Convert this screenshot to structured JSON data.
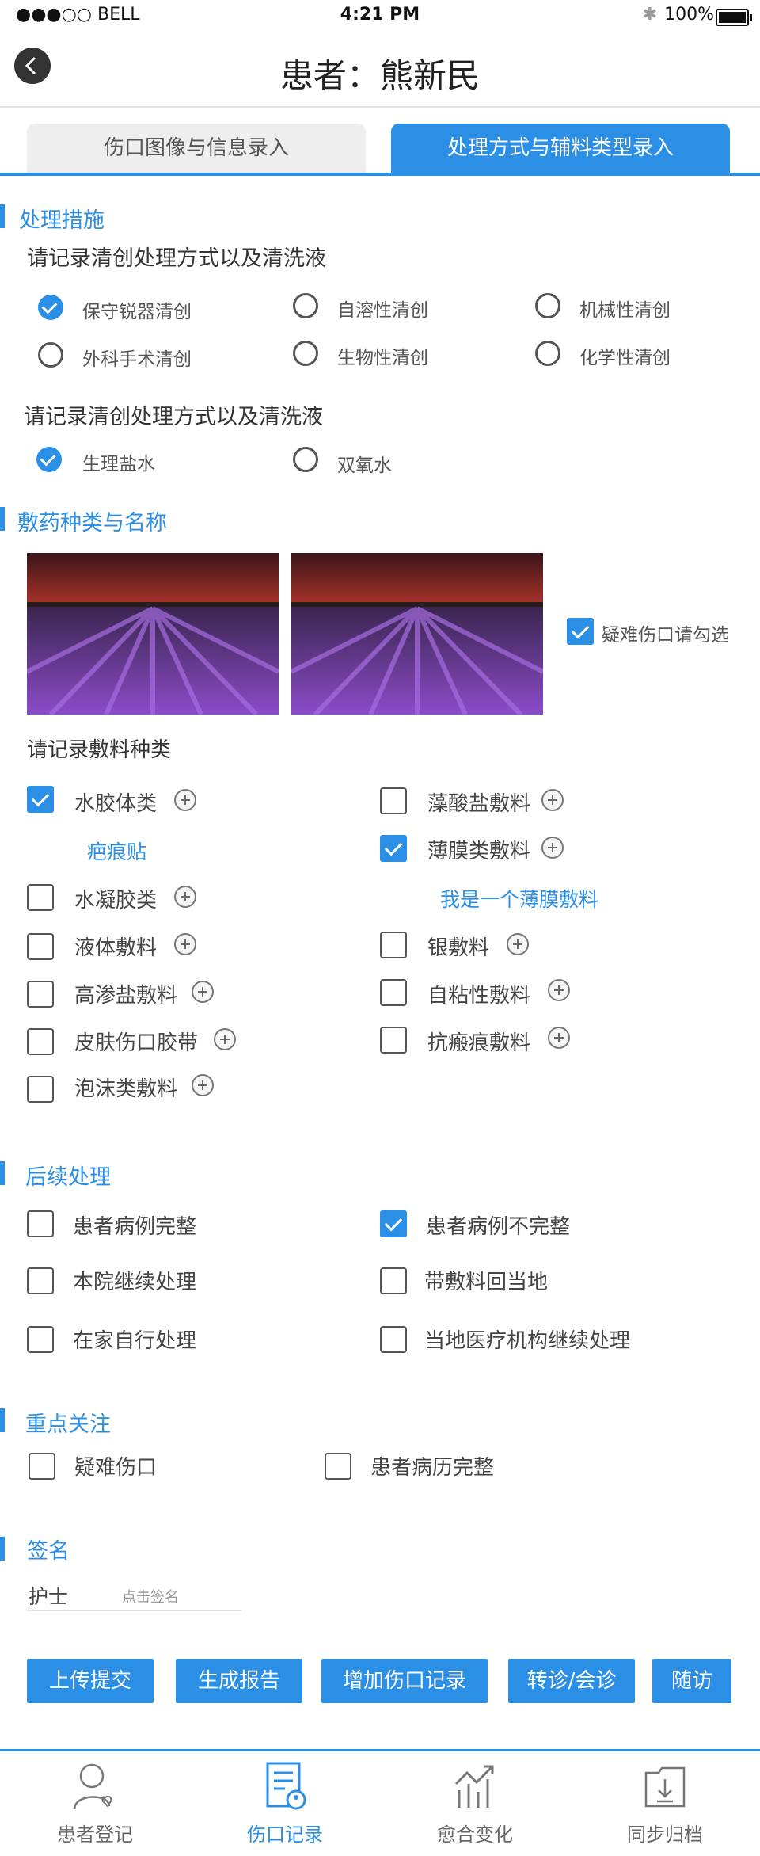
{
  "status_bar": {
    "carrier": "●●●○○ BELL",
    "time": "4:21 PM",
    "battery": "100%"
  },
  "header": {
    "back_icon": "chevron-left-icon",
    "title": "患者：熊新民"
  },
  "tabs": [
    {
      "label": "伤口图像与信息录入",
      "active": false
    },
    {
      "label": "处理方式与辅料类型录入",
      "active": true
    }
  ],
  "treatment": {
    "title": "处理措施",
    "debridement_question": "请记录清创处理方式以及清洗液",
    "debridement_options": [
      {
        "label": "保守锐器清创",
        "checked": true
      },
      {
        "label": "自溶性清创",
        "checked": false
      },
      {
        "label": "机械性清创",
        "checked": false
      },
      {
        "label": "外科手术清创",
        "checked": false
      },
      {
        "label": "生物性清创",
        "checked": false
      },
      {
        "label": "化学性清创",
        "checked": false
      }
    ],
    "solution_question": "请记录清创处理方式以及清洗液",
    "solution_options": [
      {
        "label": "生理盐水",
        "checked": true
      },
      {
        "label": "双氧水",
        "checked": false
      }
    ]
  },
  "dressing": {
    "title": "敷药种类与名称",
    "difficult_wound_check": {
      "label": "疑难伤口请勾选",
      "checked": true
    },
    "type_question": "请记录敷料种类",
    "left": [
      {
        "label": "水胶体类",
        "checked": true,
        "note": "疤痕贴"
      },
      {
        "label": "水凝胶类",
        "checked": false
      },
      {
        "label": "液体敷料",
        "checked": false
      },
      {
        "label": "高渗盐敷料",
        "checked": false
      },
      {
        "label": "皮肤伤口胶带",
        "checked": false
      },
      {
        "label": "泡沫类敷料",
        "checked": false
      }
    ],
    "right": [
      {
        "label": "藻酸盐敷料",
        "checked": false
      },
      {
        "label": "薄膜类敷料",
        "checked": true,
        "note": "我是一个薄膜敷料"
      },
      {
        "label": "银敷料",
        "checked": false
      },
      {
        "label": "自粘性敷料",
        "checked": false
      },
      {
        "label": "抗瘢痕敷料",
        "checked": false
      }
    ]
  },
  "followup": {
    "title": "后续处理",
    "options": [
      {
        "label": "患者病例完整",
        "checked": false
      },
      {
        "label": "患者病例不完整",
        "checked": true
      },
      {
        "label": "本院继续处理",
        "checked": false
      },
      {
        "label": "带敷料回当地",
        "checked": false
      },
      {
        "label": "在家自行处理",
        "checked": false
      },
      {
        "label": "当地医疗机构继续处理",
        "checked": false
      }
    ]
  },
  "focus": {
    "title": "重点关注",
    "options": [
      {
        "label": "疑难伤口",
        "checked": false
      },
      {
        "label": "患者病历完整",
        "checked": false
      }
    ]
  },
  "signature": {
    "title": "签名",
    "nurse_label": "护士",
    "hint": "点击签名"
  },
  "actions": [
    "上传提交",
    "生成报告",
    "增加伤口记录",
    "转诊/会诊",
    "随访"
  ],
  "bottom_nav": [
    {
      "label": "患者登记",
      "icon": "patient-register-icon",
      "active": false
    },
    {
      "label": "伤口记录",
      "icon": "wound-record-icon",
      "active": true
    },
    {
      "label": "愈合变化",
      "icon": "healing-chart-icon",
      "active": false
    },
    {
      "label": "同步归档",
      "icon": "sync-archive-icon",
      "active": false
    }
  ],
  "colors": {
    "accent": "#2b8fe6"
  }
}
